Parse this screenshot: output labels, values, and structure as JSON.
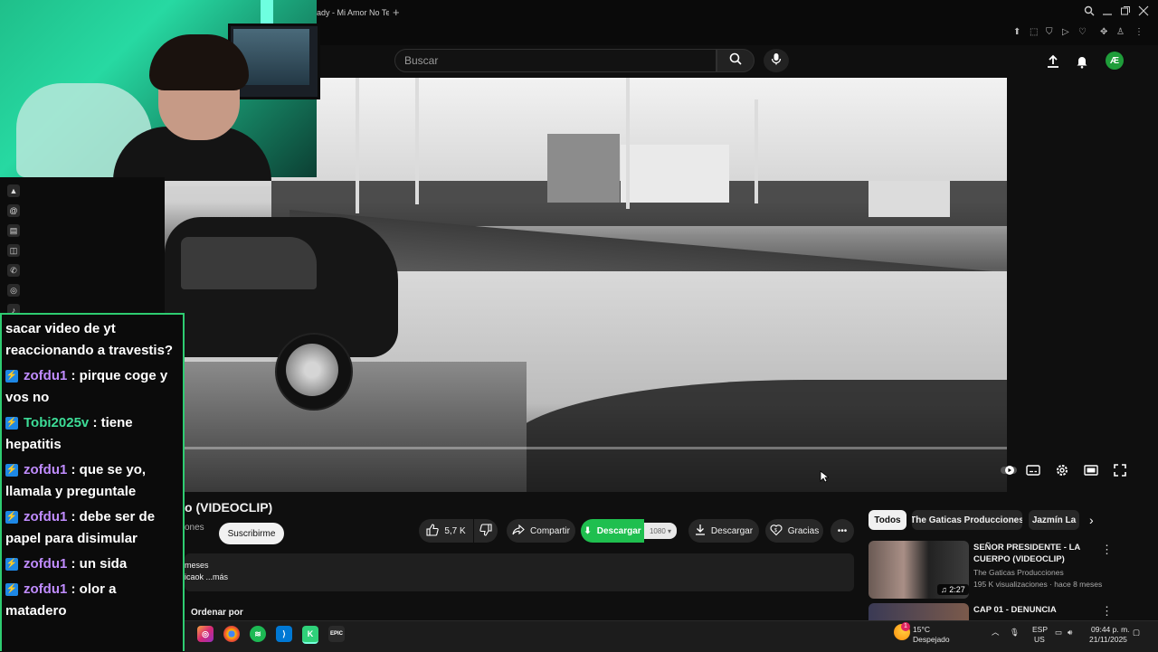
{
  "browser": {
    "tab_title": "ady - Mi Amor No Te",
    "new_tab_glyph": "+"
  },
  "youtube": {
    "search": {
      "placeholder": "Buscar"
    },
    "video": {
      "title": "o (VIDEOCLIP)",
      "channel_fragment": "ones",
      "subscribe_label": "Suscribirme",
      "like_count": "5,7 K",
      "share_label": "Compartir",
      "download_ext_label": "Descargar",
      "download_quality": "1080",
      "download_label": "Descargar",
      "thanks_label": "Gracias",
      "description_line1": "meses",
      "description_line2": "icaok ...más",
      "sort_label": "Ordenar por"
    },
    "chips": [
      "Todos",
      "The Gaticas Producciones",
      "Jazmín La"
    ],
    "related": [
      {
        "title": "SEÑOR PRESIDENTE - LA CUERPO (VIDEOCLIP)",
        "channel": "The Gaticas Producciones",
        "meta": "195 K visualizaciones · hace 8 meses",
        "duration": "2:27"
      },
      {
        "title": "CAP 01 - DENUNCIA",
        "channel": "",
        "meta": "",
        "duration": ""
      }
    ]
  },
  "chat": {
    "messages": [
      {
        "user": "",
        "text": "sacar video de yt reaccionando a travestis?",
        "color": "#ffffff"
      },
      {
        "user": "zofdu1",
        "text": ": pirque coge y vos no",
        "color": "#c08cff"
      },
      {
        "user": "Tobi2025v",
        "text": ": tiene hepatitis",
        "color": "#3ddc97"
      },
      {
        "user": "zofdu1",
        "text": ": que se yo, llamala y preguntale",
        "color": "#c08cff"
      },
      {
        "user": "zofdu1",
        "text": ": debe ser de papel para disimular",
        "color": "#c08cff"
      },
      {
        "user": "zofdu1",
        "text": ": un sida",
        "color": "#c08cff"
      },
      {
        "user": "zofdu1",
        "text": ": olor a matadero",
        "color": "#c08cff"
      }
    ]
  },
  "taskbar": {
    "weather_temp": "15°C",
    "weather_desc": "Despejado",
    "weather_badge": "1",
    "lang_line1": "ESP",
    "lang_line2": "US",
    "time": "09:44 p. m.",
    "date": "21/11/2025"
  },
  "colors": {
    "accent_green": "#1fbf4f",
    "chat_border": "#2ecc71",
    "webcam_teal": "#27d9a2"
  }
}
